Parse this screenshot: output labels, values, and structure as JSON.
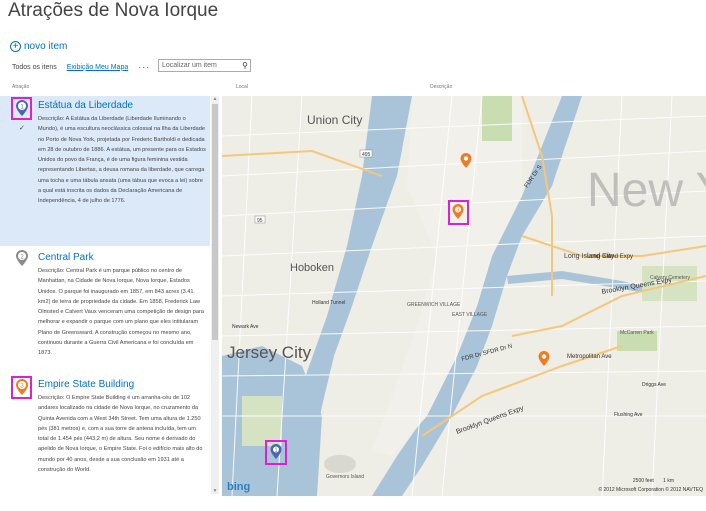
{
  "page": {
    "title": "Atrações de Nova Iorque"
  },
  "toolbar": {
    "new_item": "novo item",
    "views": [
      "Todos os itens",
      "Exibição Meu Mapa"
    ],
    "more": "···",
    "search_placeholder": "Localizar um item"
  },
  "columns": {
    "attraction": "Atração",
    "local": "Local",
    "description": "Descrição"
  },
  "items": [
    {
      "number": "1",
      "title": "Estátua da Liberdade",
      "description": "Descrição: A Estátua da Liberdade (Liberdade Iluminando o Mundo), é uma escultura neoclássica colossal na Ilha da Liberdade no Porto de Nova York, projetada por Frederic Bartholdi e dedicada em 28 de outubro de 1886. A estátua, um presente para os Estados Unidos do povo da França, é de uma figura feminina vestida representando Libertas, a deusa romana da liberdade, que carrega uma tocha e uma tábula ansata (uma tábua que evoca a lei) sobre a qual está inscrita os dados da Declaração Americana de Independência, 4 de julho de 1776.",
      "selected": true
    },
    {
      "number": "2",
      "title": "Central Park",
      "description": "Descrição: Central Park é um parque público no centro de Manhattan, na Cidade de Nova Iorque, Nova Iorque, Estados Unidos. O parque foi inaugurado em 1857, em 843 acres (3.41 km2) de terra de propriedade da cidade. Em 1858, Frederick Law Olmsted e Calvert Vaux venceram uma competição de design para melhorar e expandir o parque com um plano que eles intitularam Plano de Greensward. A construção começou no mesmo ano, continuou durante a Guerra Civil Americana e foi concluída em 1873.",
      "selected": false
    },
    {
      "number": "3",
      "title": "Empire State Building",
      "description": "Descrição: O Empire State Building é um arranha-céu de 102 andares localizado na cidade de Nova Iorque, no cruzamento da Quinta Avenida com a West 34th Street. Tem uma altura de 1.250 pés (381 metros) e, com a sua torre de antena incluída, tem um total de 1.454 pés (443,2 m) de altura. Seu nome é derivado do apelido de Nova Iorque, o Empire State. Foi o edifício mais alto do mundo por 40 anos, desde a sua conclusão em 1931 até a construção do World.",
      "selected": false
    }
  ],
  "map": {
    "labels": {
      "union_city": "Union City",
      "hoboken": "Hoboken",
      "jersey_city": "Jersey City",
      "new_york": "New Yor",
      "long_island_city": "Long Island City",
      "greenwich": "GREENWICH VILLAGE",
      "east_village": "EAST VILLAGE",
      "fdr1": "FDR Dr S",
      "fdr2": "FDR Dr SFDR Dr N",
      "bqe": "Brooklyn Queens Expy",
      "lie": "Long Island Expy",
      "metropolitan": "Metropolitan Ave",
      "calvary": "Calvary Cemetery",
      "mccarren": "McCarren Park",
      "governors": "Governors Island",
      "holland": "Holland Tunnel",
      "newark": "Newark Ave",
      "ave495": "495",
      "ave95": "95",
      "flushing": "Flushing Ave",
      "driggs": "Driggs Ave"
    },
    "brand": "bing",
    "scale": "2500 feet",
    "scale_km": "1 km",
    "copyright": "© 2012 Microsoft Corporation  © 2012 NAVTEQ"
  },
  "colors": {
    "accent": "#0072c6",
    "highlight": "#e020d0",
    "pin_blue": "#4a67a8",
    "pin_orange": "#ee7c22",
    "pin_gray": "#8a8a8a",
    "water": "#a9c4d9",
    "park": "#c9deb0"
  }
}
